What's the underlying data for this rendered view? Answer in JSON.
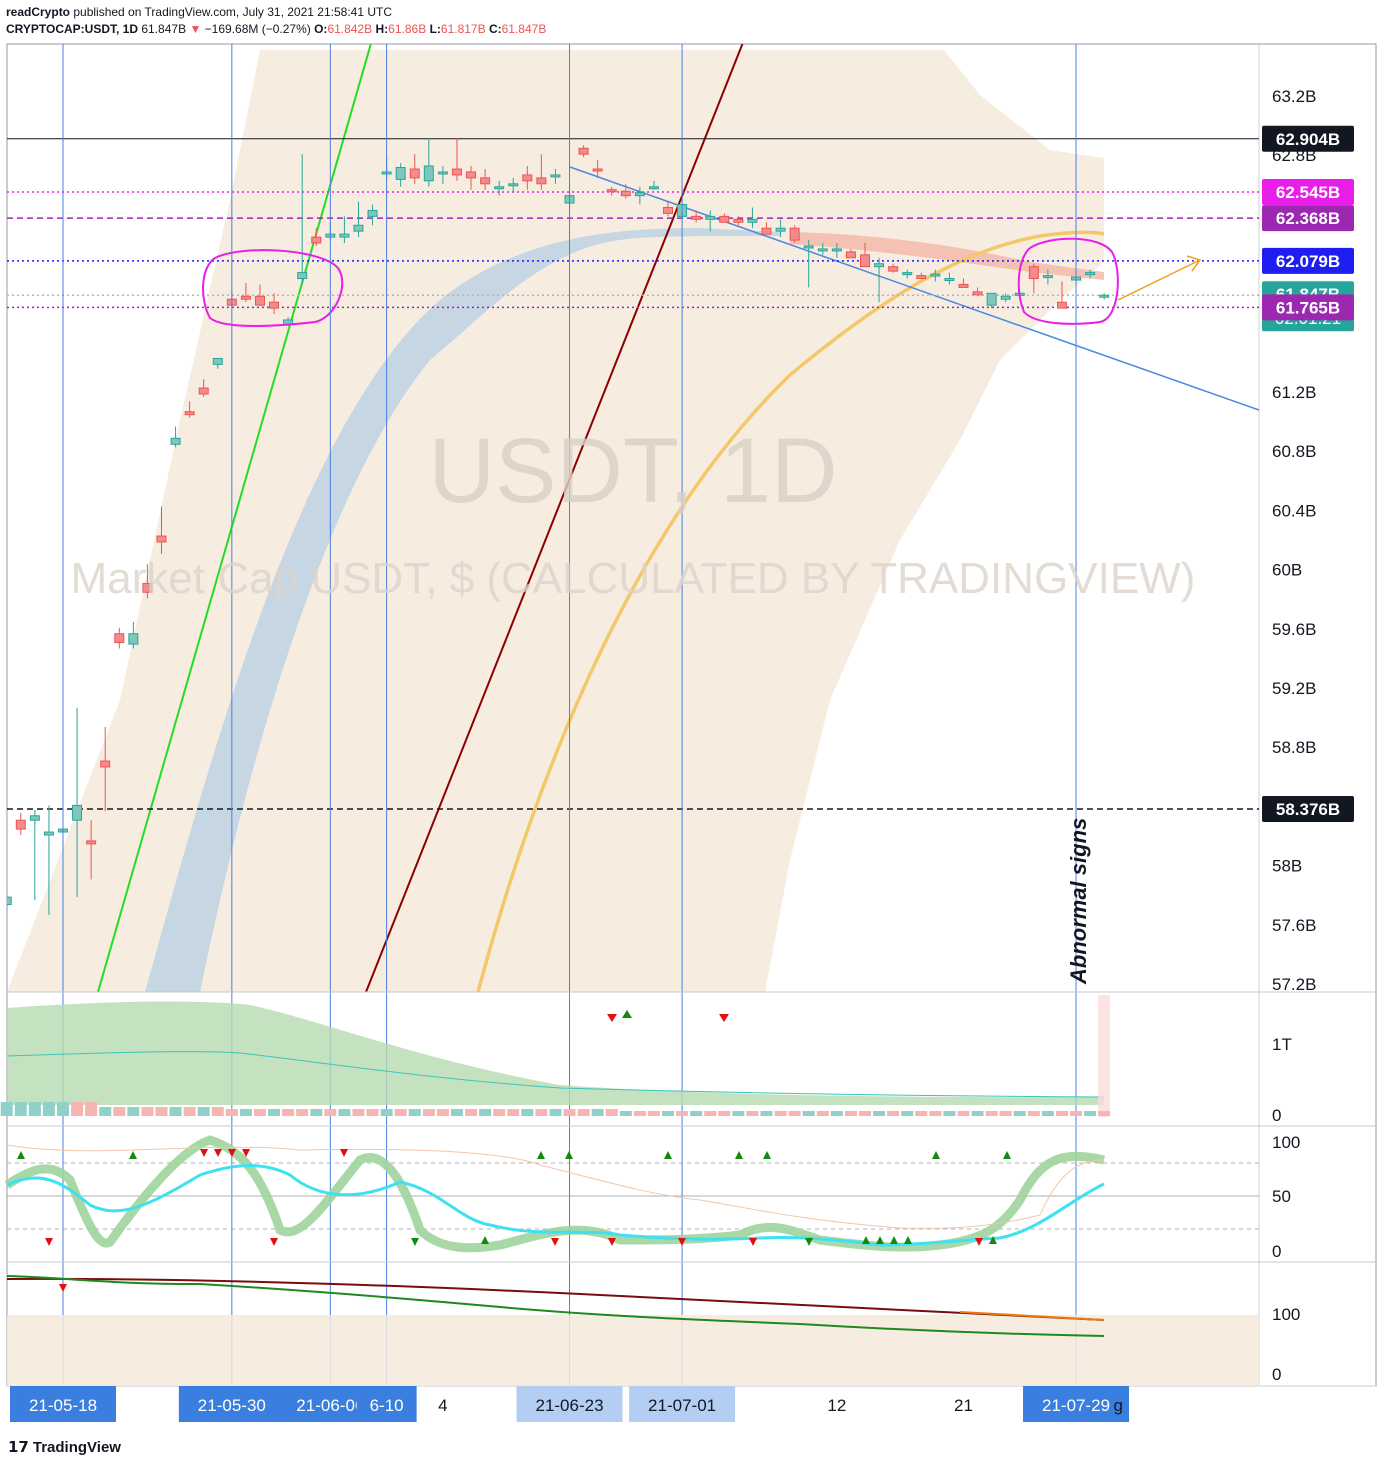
{
  "header": {
    "publisher": "readCrypto",
    "published_text": " published on TradingView.com, July 31, 2021 21:58:41 UTC",
    "symbol": "CRYPTOCAP:USDT, 1D",
    "last": "61.847B",
    "change": "−169.68M (−0.27%)",
    "open_label": "O:",
    "open": "61.842B",
    "high_label": "H:",
    "high": "61.86B",
    "low_label": "L:",
    "low": "61.817B",
    "close_label": "C:",
    "close": "61.847B"
  },
  "watermark": {
    "symbol": "USDT, 1D",
    "description": "Market Cap USDT, $ (CALCULATED BY TRADINGVIEW)"
  },
  "annotation": {
    "text": "Abnormal signs"
  },
  "footer": {
    "brand": "TradingView",
    "logo_icon": "tradingview-logo-icon"
  },
  "chart_data": [
    {
      "type": "candlestick",
      "panel": "price",
      "title": "USDT, 1D",
      "y_ticks": [
        "63.2B",
        "62.8B",
        "61.2B",
        "60.8B",
        "60.4B",
        "60B",
        "59.6B",
        "59.2B",
        "58.8B",
        "58B",
        "57.6B",
        "57.2B"
      ],
      "ylim": [
        57.16,
        64.0
      ],
      "x_labels": [
        {
          "label": "21-05-18",
          "day": 0,
          "highlight": "strong"
        },
        {
          "label": "21-05-30",
          "day": 12,
          "highlight": "strong"
        },
        {
          "label": "21-06-06",
          "day": 19,
          "highlight": "strong"
        },
        {
          "label": "6-10",
          "day": 23,
          "highlight": "strong"
        },
        {
          "label": "4",
          "day": 27,
          "highlight": "none"
        },
        {
          "label": "21-06-23",
          "day": 36,
          "highlight": "light"
        },
        {
          "label": "21-07-01",
          "day": 44,
          "highlight": "light"
        },
        {
          "label": "12",
          "day": 55,
          "highlight": "none"
        },
        {
          "label": "21",
          "day": 64,
          "highlight": "none"
        },
        {
          "label": "21-07-29",
          "day": 72,
          "highlight": "strong"
        },
        {
          "label": "g",
          "day": 75,
          "highlight": "none"
        }
      ],
      "price_labels": [
        {
          "value": 62.904,
          "text": "62.904B",
          "color": "#131722",
          "line": "solid",
          "line_color": "#131722"
        },
        {
          "value": 62.545,
          "text": "62.545B",
          "color": "#e91ee9",
          "line": "dotted",
          "line_color": "#e91ee9"
        },
        {
          "value": 62.368,
          "text": "62.368B",
          "color": "#9c27b0",
          "line": "dashed",
          "line_color": "#9c27b0"
        },
        {
          "value": 62.079,
          "text": "62.079B",
          "color": "#1e1ef0",
          "line": "dotted",
          "line_color": "#1e1ef0"
        },
        {
          "value": 61.847,
          "text": "61.847B",
          "text2": "02:01:21",
          "color": "#26a69a",
          "line": "dotted",
          "line_color": "#b2b5be"
        },
        {
          "value": 61.765,
          "text": "61.765B",
          "color": "#9c27b0",
          "line": "dotted",
          "line_color": "#9c27b0"
        },
        {
          "value": 58.376,
          "text": "58.376B",
          "color": "#131722",
          "line": "dashed",
          "line_color": "#131722"
        }
      ],
      "candles": [
        {
          "d": -4,
          "o": 57.73,
          "h": 57.8,
          "l": 57.7,
          "c": 57.78
        },
        {
          "d": -3,
          "o": 58.3,
          "h": 58.35,
          "l": 58.2,
          "c": 58.24
        },
        {
          "d": -2,
          "o": 58.3,
          "h": 58.37,
          "l": 57.76,
          "c": 58.33
        },
        {
          "d": -1,
          "o": 58.2,
          "h": 58.4,
          "l": 57.66,
          "c": 58.22
        },
        {
          "d": 0,
          "o": 58.22,
          "h": 58.4,
          "l": 58.0,
          "c": 58.24
        },
        {
          "d": 1,
          "o": 58.3,
          "h": 59.06,
          "l": 57.78,
          "c": 58.4
        },
        {
          "d": 2,
          "o": 58.16,
          "h": 58.3,
          "l": 57.9,
          "c": 58.14
        },
        {
          "d": 3,
          "o": 58.7,
          "h": 58.93,
          "l": 58.36,
          "c": 58.66
        },
        {
          "d": 4,
          "o": 59.56,
          "h": 59.6,
          "l": 59.46,
          "c": 59.5
        },
        {
          "d": 5,
          "o": 59.49,
          "h": 59.64,
          "l": 59.46,
          "c": 59.56
        },
        {
          "d": 6,
          "o": 59.9,
          "h": 60.03,
          "l": 59.8,
          "c": 59.84
        },
        {
          "d": 7,
          "o": 60.22,
          "h": 60.42,
          "l": 60.1,
          "c": 60.18
        },
        {
          "d": 8,
          "o": 60.84,
          "h": 60.96,
          "l": 60.82,
          "c": 60.88
        },
        {
          "d": 9,
          "o": 61.06,
          "h": 61.13,
          "l": 61.02,
          "c": 61.04
        },
        {
          "d": 10,
          "o": 61.22,
          "h": 61.28,
          "l": 61.16,
          "c": 61.18
        },
        {
          "d": 11,
          "o": 61.38,
          "h": 61.42,
          "l": 61.35,
          "c": 61.42
        },
        {
          "d": 12,
          "o": 61.82,
          "h": 61.88,
          "l": 61.78,
          "c": 61.78
        },
        {
          "d": 13,
          "o": 61.84,
          "h": 61.93,
          "l": 61.8,
          "c": 61.82
        },
        {
          "d": 14,
          "o": 61.84,
          "h": 61.92,
          "l": 61.78,
          "c": 61.78
        },
        {
          "d": 15,
          "o": 61.8,
          "h": 61.86,
          "l": 61.72,
          "c": 61.76
        },
        {
          "d": 16,
          "o": 61.65,
          "h": 61.7,
          "l": 61.64,
          "c": 61.68
        },
        {
          "d": 17,
          "o": 61.96,
          "h": 62.8,
          "l": 61.92,
          "c": 62.0
        },
        {
          "d": 18,
          "o": 62.24,
          "h": 62.3,
          "l": 62.18,
          "c": 62.2
        },
        {
          "d": 19,
          "o": 62.24,
          "h": 62.34,
          "l": 62.22,
          "c": 62.26
        },
        {
          "d": 20,
          "o": 62.24,
          "h": 62.38,
          "l": 62.2,
          "c": 62.26
        },
        {
          "d": 21,
          "o": 62.28,
          "h": 62.48,
          "l": 62.24,
          "c": 62.32
        },
        {
          "d": 22,
          "o": 62.38,
          "h": 62.46,
          "l": 62.32,
          "c": 62.42
        },
        {
          "d": 23,
          "o": 62.68,
          "h": 62.78,
          "l": 62.62,
          "c": 62.68
        },
        {
          "d": 24,
          "o": 62.63,
          "h": 62.74,
          "l": 62.58,
          "c": 62.71
        },
        {
          "d": 25,
          "o": 62.7,
          "h": 62.8,
          "l": 62.6,
          "c": 62.64
        },
        {
          "d": 26,
          "o": 62.62,
          "h": 62.91,
          "l": 62.58,
          "c": 62.72
        },
        {
          "d": 27,
          "o": 62.67,
          "h": 62.72,
          "l": 62.6,
          "c": 62.68
        },
        {
          "d": 28,
          "o": 62.7,
          "h": 62.91,
          "l": 62.62,
          "c": 62.66
        },
        {
          "d": 29,
          "o": 62.68,
          "h": 62.72,
          "l": 62.56,
          "c": 62.64
        },
        {
          "d": 30,
          "o": 62.64,
          "h": 62.7,
          "l": 62.56,
          "c": 62.6
        },
        {
          "d": 31,
          "o": 62.58,
          "h": 62.62,
          "l": 62.52,
          "c": 62.58
        },
        {
          "d": 32,
          "o": 62.59,
          "h": 62.64,
          "l": 62.54,
          "c": 62.6
        },
        {
          "d": 33,
          "o": 62.66,
          "h": 62.72,
          "l": 62.56,
          "c": 62.62
        },
        {
          "d": 34,
          "o": 62.64,
          "h": 62.8,
          "l": 62.56,
          "c": 62.6
        },
        {
          "d": 35,
          "o": 62.66,
          "h": 62.7,
          "l": 62.6,
          "c": 62.66
        },
        {
          "d": 36,
          "o": 62.47,
          "h": 62.62,
          "l": 62.34,
          "c": 62.52
        },
        {
          "d": 37,
          "o": 62.84,
          "h": 62.86,
          "l": 62.78,
          "c": 62.8
        },
        {
          "d": 38,
          "o": 62.7,
          "h": 62.76,
          "l": 62.64,
          "c": 62.69
        },
        {
          "d": 39,
          "o": 62.56,
          "h": 62.58,
          "l": 62.52,
          "c": 62.55
        },
        {
          "d": 40,
          "o": 62.55,
          "h": 62.6,
          "l": 62.5,
          "c": 62.52
        },
        {
          "d": 41,
          "o": 62.52,
          "h": 62.58,
          "l": 62.46,
          "c": 62.54
        },
        {
          "d": 42,
          "o": 62.58,
          "h": 62.62,
          "l": 62.56,
          "c": 62.58
        },
        {
          "d": 43,
          "o": 62.44,
          "h": 62.48,
          "l": 62.38,
          "c": 62.4
        },
        {
          "d": 44,
          "o": 62.38,
          "h": 62.5,
          "l": 62.36,
          "c": 62.46
        },
        {
          "d": 45,
          "o": 62.38,
          "h": 62.42,
          "l": 62.34,
          "c": 62.36
        },
        {
          "d": 46,
          "o": 62.36,
          "h": 62.42,
          "l": 62.28,
          "c": 62.38
        },
        {
          "d": 47,
          "o": 62.38,
          "h": 62.4,
          "l": 62.34,
          "c": 62.34
        },
        {
          "d": 48,
          "o": 62.36,
          "h": 62.38,
          "l": 62.32,
          "c": 62.34
        },
        {
          "d": 49,
          "o": 62.34,
          "h": 62.44,
          "l": 62.3,
          "c": 62.36
        },
        {
          "d": 50,
          "o": 62.3,
          "h": 62.34,
          "l": 62.26,
          "c": 62.26
        },
        {
          "d": 51,
          "o": 62.28,
          "h": 62.36,
          "l": 62.24,
          "c": 62.3
        },
        {
          "d": 52,
          "o": 62.3,
          "h": 62.32,
          "l": 62.2,
          "c": 62.22
        },
        {
          "d": 53,
          "o": 62.18,
          "h": 62.22,
          "l": 61.9,
          "c": 62.18
        },
        {
          "d": 54,
          "o": 62.16,
          "h": 62.2,
          "l": 62.12,
          "c": 62.16
        },
        {
          "d": 55,
          "o": 62.16,
          "h": 62.2,
          "l": 62.1,
          "c": 62.16
        },
        {
          "d": 56,
          "o": 62.14,
          "h": 62.16,
          "l": 62.1,
          "c": 62.1
        },
        {
          "d": 57,
          "o": 62.12,
          "h": 62.2,
          "l": 62.08,
          "c": 62.04
        },
        {
          "d": 58,
          "o": 62.04,
          "h": 62.1,
          "l": 61.8,
          "c": 62.06
        },
        {
          "d": 59,
          "o": 62.04,
          "h": 62.06,
          "l": 62.0,
          "c": 62.01
        },
        {
          "d": 60,
          "o": 61.99,
          "h": 62.02,
          "l": 61.96,
          "c": 62.0
        },
        {
          "d": 61,
          "o": 61.98,
          "h": 62.0,
          "l": 61.96,
          "c": 61.96
        },
        {
          "d": 62,
          "o": 61.98,
          "h": 62.02,
          "l": 61.94,
          "c": 61.99
        },
        {
          "d": 63,
          "o": 61.96,
          "h": 62.0,
          "l": 61.92,
          "c": 61.96
        },
        {
          "d": 64,
          "o": 61.92,
          "h": 61.96,
          "l": 61.9,
          "c": 61.9
        },
        {
          "d": 65,
          "o": 61.87,
          "h": 61.9,
          "l": 61.84,
          "c": 61.85
        },
        {
          "d": 66,
          "o": 61.78,
          "h": 61.86,
          "l": 61.76,
          "c": 61.86
        },
        {
          "d": 67,
          "o": 61.82,
          "h": 61.86,
          "l": 61.8,
          "c": 61.84
        },
        {
          "d": 68,
          "o": 61.86,
          "h": 61.88,
          "l": 61.84,
          "c": 61.86
        },
        {
          "d": 69,
          "o": 62.04,
          "h": 62.06,
          "l": 61.86,
          "c": 61.96
        },
        {
          "d": 70,
          "o": 61.98,
          "h": 62.02,
          "l": 61.92,
          "c": 61.98
        },
        {
          "d": 71,
          "o": 61.8,
          "h": 61.94,
          "l": 61.76,
          "c": 61.76
        },
        {
          "d": 72,
          "o": 61.95,
          "h": 61.98,
          "l": 61.93,
          "c": 61.97
        },
        {
          "d": 73,
          "o": 61.99,
          "h": 62.02,
          "l": 61.96,
          "c": 62.0
        },
        {
          "d": 74,
          "o": 61.842,
          "h": 61.86,
          "l": 61.817,
          "c": 61.847
        }
      ],
      "sub_panels": [
        {
          "name": "volume",
          "y_ticks": [
            "1T",
            "0"
          ]
        },
        {
          "name": "oscillator",
          "y_ticks": [
            "100",
            "50",
            "0"
          ],
          "levels": [
            80,
            50,
            20
          ]
        },
        {
          "name": "trend",
          "y_ticks": [
            "100",
            "0"
          ]
        }
      ]
    }
  ],
  "colors": {
    "up": "#26a69a",
    "down": "#ef5350",
    "up_fill": "#7fc6bd",
    "down_fill": "#f28b8a",
    "band": "#f5eadb",
    "cloud": "#b6cde4",
    "orange_ma": "#f4c86a",
    "green_line": "#22dd22",
    "darkred_line": "#8b0000",
    "trend_line": "#4a88e0",
    "vline": "#4a7fe0",
    "circle": "#e91ee9",
    "arrow": "#f0a020"
  }
}
